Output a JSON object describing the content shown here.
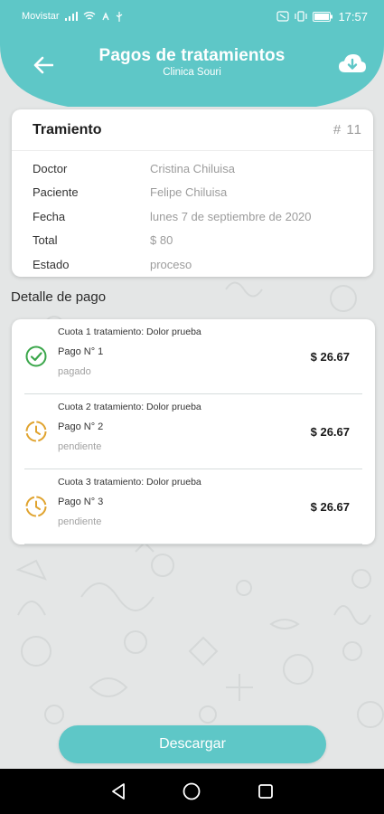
{
  "status_bar": {
    "carrier": "Movistar",
    "time": "17:57"
  },
  "header": {
    "title": "Pagos de tratamientos",
    "subtitle": "Clinica Souri",
    "back_icon": "arrow-left-icon",
    "download_icon": "cloud-download-icon",
    "color": "#5ec7c7"
  },
  "treatment": {
    "title": "Tramiento",
    "number": "# 11",
    "rows": [
      {
        "label": "Doctor",
        "value": "Cristina Chiluisa"
      },
      {
        "label": "Paciente",
        "value": "Felipe Chiluisa"
      },
      {
        "label": "Fecha",
        "value": "lunes 7 de septiembre de 2020"
      },
      {
        "label": "Total",
        "value": "$ 80"
      },
      {
        "label": "Estado",
        "value": "proceso"
      }
    ]
  },
  "payments": {
    "section_title": "Detalle de pago",
    "items": [
      {
        "description": "Cuota 1 tratamiento: Dolor prueba",
        "number": "Pago N° 1",
        "state": "pagado",
        "amount": "$ 26.67",
        "icon": "check-circle-icon",
        "icon_color": "#3aa64a"
      },
      {
        "description": "Cuota 2 tratamiento: Dolor prueba",
        "number": "Pago N° 2",
        "state": "pendiente",
        "amount": "$ 26.67",
        "icon": "clock-icon",
        "icon_color": "#e0a32e"
      },
      {
        "description": "Cuota 3 tratamiento: Dolor prueba",
        "number": "Pago N° 3",
        "state": "pendiente",
        "amount": "$ 26.67",
        "icon": "clock-icon",
        "icon_color": "#e0a32e"
      }
    ]
  },
  "actions": {
    "download_label": "Descargar"
  },
  "nav": {
    "back": "nav-back-icon",
    "home": "nav-home-icon",
    "recents": "nav-recents-icon"
  }
}
